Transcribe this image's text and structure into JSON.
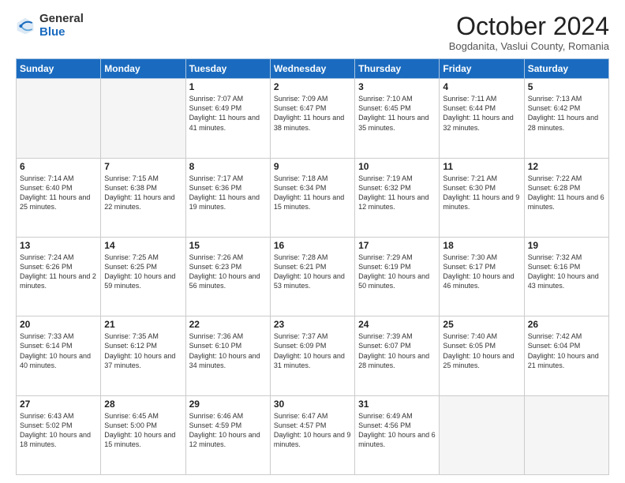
{
  "logo": {
    "general": "General",
    "blue": "Blue",
    "icon_title": "GeneralBlue logo"
  },
  "header": {
    "month": "October 2024",
    "location": "Bogdanita, Vaslui County, Romania"
  },
  "weekdays": [
    "Sunday",
    "Monday",
    "Tuesday",
    "Wednesday",
    "Thursday",
    "Friday",
    "Saturday"
  ],
  "weeks": [
    [
      {
        "day": "",
        "info": ""
      },
      {
        "day": "",
        "info": ""
      },
      {
        "day": "1",
        "info": "Sunrise: 7:07 AM\nSunset: 6:49 PM\nDaylight: 11 hours and 41 minutes."
      },
      {
        "day": "2",
        "info": "Sunrise: 7:09 AM\nSunset: 6:47 PM\nDaylight: 11 hours and 38 minutes."
      },
      {
        "day": "3",
        "info": "Sunrise: 7:10 AM\nSunset: 6:45 PM\nDaylight: 11 hours and 35 minutes."
      },
      {
        "day": "4",
        "info": "Sunrise: 7:11 AM\nSunset: 6:44 PM\nDaylight: 11 hours and 32 minutes."
      },
      {
        "day": "5",
        "info": "Sunrise: 7:13 AM\nSunset: 6:42 PM\nDaylight: 11 hours and 28 minutes."
      }
    ],
    [
      {
        "day": "6",
        "info": "Sunrise: 7:14 AM\nSunset: 6:40 PM\nDaylight: 11 hours and 25 minutes."
      },
      {
        "day": "7",
        "info": "Sunrise: 7:15 AM\nSunset: 6:38 PM\nDaylight: 11 hours and 22 minutes."
      },
      {
        "day": "8",
        "info": "Sunrise: 7:17 AM\nSunset: 6:36 PM\nDaylight: 11 hours and 19 minutes."
      },
      {
        "day": "9",
        "info": "Sunrise: 7:18 AM\nSunset: 6:34 PM\nDaylight: 11 hours and 15 minutes."
      },
      {
        "day": "10",
        "info": "Sunrise: 7:19 AM\nSunset: 6:32 PM\nDaylight: 11 hours and 12 minutes."
      },
      {
        "day": "11",
        "info": "Sunrise: 7:21 AM\nSunset: 6:30 PM\nDaylight: 11 hours and 9 minutes."
      },
      {
        "day": "12",
        "info": "Sunrise: 7:22 AM\nSunset: 6:28 PM\nDaylight: 11 hours and 6 minutes."
      }
    ],
    [
      {
        "day": "13",
        "info": "Sunrise: 7:24 AM\nSunset: 6:26 PM\nDaylight: 11 hours and 2 minutes."
      },
      {
        "day": "14",
        "info": "Sunrise: 7:25 AM\nSunset: 6:25 PM\nDaylight: 10 hours and 59 minutes."
      },
      {
        "day": "15",
        "info": "Sunrise: 7:26 AM\nSunset: 6:23 PM\nDaylight: 10 hours and 56 minutes."
      },
      {
        "day": "16",
        "info": "Sunrise: 7:28 AM\nSunset: 6:21 PM\nDaylight: 10 hours and 53 minutes."
      },
      {
        "day": "17",
        "info": "Sunrise: 7:29 AM\nSunset: 6:19 PM\nDaylight: 10 hours and 50 minutes."
      },
      {
        "day": "18",
        "info": "Sunrise: 7:30 AM\nSunset: 6:17 PM\nDaylight: 10 hours and 46 minutes."
      },
      {
        "day": "19",
        "info": "Sunrise: 7:32 AM\nSunset: 6:16 PM\nDaylight: 10 hours and 43 minutes."
      }
    ],
    [
      {
        "day": "20",
        "info": "Sunrise: 7:33 AM\nSunset: 6:14 PM\nDaylight: 10 hours and 40 minutes."
      },
      {
        "day": "21",
        "info": "Sunrise: 7:35 AM\nSunset: 6:12 PM\nDaylight: 10 hours and 37 minutes."
      },
      {
        "day": "22",
        "info": "Sunrise: 7:36 AM\nSunset: 6:10 PM\nDaylight: 10 hours and 34 minutes."
      },
      {
        "day": "23",
        "info": "Sunrise: 7:37 AM\nSunset: 6:09 PM\nDaylight: 10 hours and 31 minutes."
      },
      {
        "day": "24",
        "info": "Sunrise: 7:39 AM\nSunset: 6:07 PM\nDaylight: 10 hours and 28 minutes."
      },
      {
        "day": "25",
        "info": "Sunrise: 7:40 AM\nSunset: 6:05 PM\nDaylight: 10 hours and 25 minutes."
      },
      {
        "day": "26",
        "info": "Sunrise: 7:42 AM\nSunset: 6:04 PM\nDaylight: 10 hours and 21 minutes."
      }
    ],
    [
      {
        "day": "27",
        "info": "Sunrise: 6:43 AM\nSunset: 5:02 PM\nDaylight: 10 hours and 18 minutes."
      },
      {
        "day": "28",
        "info": "Sunrise: 6:45 AM\nSunset: 5:00 PM\nDaylight: 10 hours and 15 minutes."
      },
      {
        "day": "29",
        "info": "Sunrise: 6:46 AM\nSunset: 4:59 PM\nDaylight: 10 hours and 12 minutes."
      },
      {
        "day": "30",
        "info": "Sunrise: 6:47 AM\nSunset: 4:57 PM\nDaylight: 10 hours and 9 minutes."
      },
      {
        "day": "31",
        "info": "Sunrise: 6:49 AM\nSunset: 4:56 PM\nDaylight: 10 hours and 6 minutes."
      },
      {
        "day": "",
        "info": ""
      },
      {
        "day": "",
        "info": ""
      }
    ]
  ]
}
